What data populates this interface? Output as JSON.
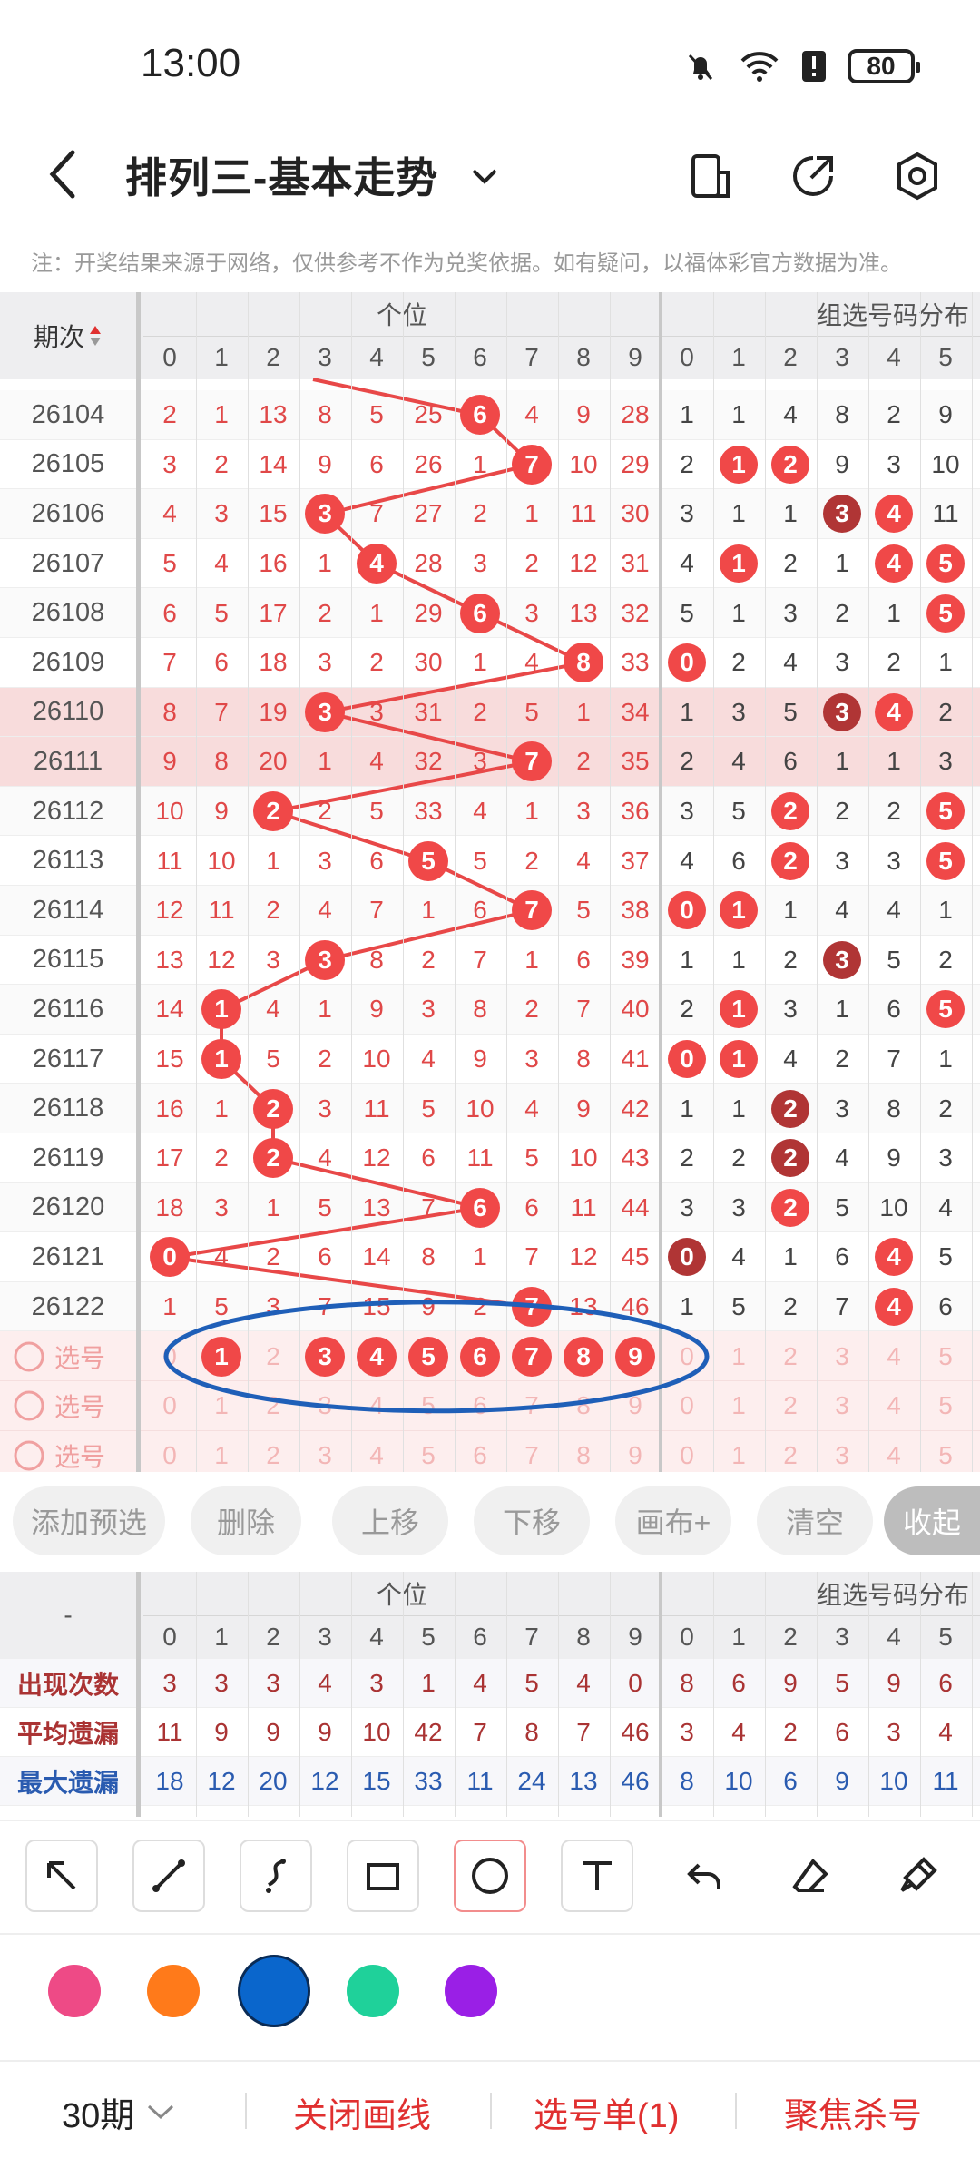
{
  "status_bar": {
    "time": "13:00",
    "battery": "80"
  },
  "header": {
    "title": "排列三-基本走势"
  },
  "note": "注：开奖结果来源于网络，仅供参考不作为兑奖依据。如有疑问，以福体彩官方数据为准。",
  "table": {
    "period_header": "期次",
    "group_unit": "个位",
    "group_combo": "组选号码分布",
    "digits": [
      "0",
      "1",
      "2",
      "3",
      "4",
      "5",
      "6",
      "7",
      "8",
      "9"
    ],
    "combo_digits": [
      "0",
      "1",
      "2",
      "3",
      "4",
      "5"
    ],
    "rows": [
      {
        "period": "26104",
        "unit": [
          "2",
          "1",
          "13",
          "8",
          "5",
          "25",
          "6",
          "4",
          "9",
          "28"
        ],
        "combo": [
          "1",
          "1",
          "4",
          "8",
          "2",
          "9"
        ],
        "unit_hit": 6,
        "combo_hits": []
      },
      {
        "period": "26105",
        "unit": [
          "3",
          "2",
          "14",
          "9",
          "6",
          "26",
          "1",
          "7",
          "10",
          "29"
        ],
        "combo": [
          "2",
          "1",
          "2",
          "9",
          "3",
          "10"
        ],
        "unit_hit": 7,
        "combo_hits": [
          1,
          2
        ]
      },
      {
        "period": "26106",
        "unit": [
          "4",
          "3",
          "15",
          "3",
          "7",
          "27",
          "2",
          "1",
          "11",
          "30"
        ],
        "combo": [
          "3",
          "1",
          "1",
          "3",
          "4",
          "11"
        ],
        "unit_hit": 3,
        "combo_hits": [
          3,
          4
        ],
        "dark": [
          3
        ]
      },
      {
        "period": "26107",
        "unit": [
          "5",
          "4",
          "16",
          "1",
          "4",
          "28",
          "3",
          "2",
          "12",
          "31"
        ],
        "combo": [
          "4",
          "1",
          "2",
          "1",
          "4",
          "5"
        ],
        "unit_hit": 4,
        "combo_hits": [
          1,
          4,
          5
        ]
      },
      {
        "period": "26108",
        "unit": [
          "6",
          "5",
          "17",
          "2",
          "1",
          "29",
          "6",
          "3",
          "13",
          "32"
        ],
        "combo": [
          "5",
          "1",
          "3",
          "2",
          "1",
          "5"
        ],
        "unit_hit": 6,
        "combo_hits": [
          5
        ]
      },
      {
        "period": "26109",
        "unit": [
          "7",
          "6",
          "18",
          "3",
          "2",
          "30",
          "1",
          "4",
          "8",
          "33"
        ],
        "combo": [
          "0",
          "2",
          "4",
          "3",
          "2",
          "1"
        ],
        "unit_hit": 8,
        "combo_hits": [
          0
        ]
      },
      {
        "period": "26110",
        "unit": [
          "8",
          "7",
          "19",
          "3",
          "3",
          "31",
          "2",
          "5",
          "1",
          "34"
        ],
        "combo": [
          "1",
          "3",
          "5",
          "3",
          "4",
          "2"
        ],
        "unit_hit": 3,
        "combo_hits": [
          3,
          4
        ],
        "dark": [
          3
        ]
      },
      {
        "period": "26111",
        "unit": [
          "9",
          "8",
          "20",
          "1",
          "4",
          "32",
          "3",
          "7",
          "2",
          "35"
        ],
        "combo": [
          "2",
          "4",
          "6",
          "1",
          "1",
          "3"
        ],
        "unit_hit": 7,
        "combo_hits": []
      },
      {
        "period": "26112",
        "unit": [
          "10",
          "9",
          "2",
          "2",
          "5",
          "33",
          "4",
          "1",
          "3",
          "36"
        ],
        "combo": [
          "3",
          "5",
          "2",
          "2",
          "2",
          "5"
        ],
        "unit_hit": 2,
        "combo_hits": [
          2,
          5
        ]
      },
      {
        "period": "26113",
        "unit": [
          "11",
          "10",
          "1",
          "3",
          "6",
          "5",
          "5",
          "2",
          "4",
          "37"
        ],
        "combo": [
          "4",
          "6",
          "2",
          "3",
          "3",
          "5"
        ],
        "unit_hit": 5,
        "combo_hits": [
          2,
          5
        ]
      },
      {
        "period": "26114",
        "unit": [
          "12",
          "11",
          "2",
          "4",
          "7",
          "1",
          "6",
          "7",
          "5",
          "38"
        ],
        "combo": [
          "0",
          "1",
          "1",
          "4",
          "4",
          "1"
        ],
        "unit_hit": 7,
        "combo_hits": [
          0,
          1
        ]
      },
      {
        "period": "26115",
        "unit": [
          "13",
          "12",
          "3",
          "3",
          "8",
          "2",
          "7",
          "1",
          "6",
          "39"
        ],
        "combo": [
          "1",
          "1",
          "2",
          "3",
          "5",
          "2"
        ],
        "unit_hit": 3,
        "combo_hits": [
          3
        ],
        "dark": [
          3
        ]
      },
      {
        "period": "26116",
        "unit": [
          "14",
          "1",
          "4",
          "1",
          "9",
          "3",
          "8",
          "2",
          "7",
          "40"
        ],
        "combo": [
          "2",
          "1",
          "3",
          "1",
          "6",
          "5"
        ],
        "unit_hit": 1,
        "combo_hits": [
          1,
          5
        ]
      },
      {
        "period": "26117",
        "unit": [
          "15",
          "1",
          "5",
          "2",
          "10",
          "4",
          "9",
          "3",
          "8",
          "41"
        ],
        "combo": [
          "0",
          "1",
          "4",
          "2",
          "7",
          "1"
        ],
        "unit_hit": 1,
        "combo_hits": [
          0,
          1
        ]
      },
      {
        "period": "26118",
        "unit": [
          "16",
          "1",
          "2",
          "3",
          "11",
          "5",
          "10",
          "4",
          "9",
          "42"
        ],
        "combo": [
          "1",
          "1",
          "2",
          "3",
          "8",
          "2"
        ],
        "unit_hit": 2,
        "combo_hits": [
          2
        ],
        "dark": [
          2
        ]
      },
      {
        "period": "26119",
        "unit": [
          "17",
          "2",
          "2",
          "4",
          "12",
          "6",
          "11",
          "5",
          "10",
          "43"
        ],
        "combo": [
          "2",
          "2",
          "2",
          "4",
          "9",
          "3"
        ],
        "unit_hit": 2,
        "combo_hits": [
          2
        ],
        "dark": [
          2
        ]
      },
      {
        "period": "26120",
        "unit": [
          "18",
          "3",
          "1",
          "5",
          "13",
          "7",
          "6",
          "6",
          "11",
          "44"
        ],
        "combo": [
          "3",
          "3",
          "2",
          "5",
          "10",
          "4"
        ],
        "unit_hit": 6,
        "combo_hits": [
          2
        ]
      },
      {
        "period": "26121",
        "unit": [
          "0",
          "4",
          "2",
          "6",
          "14",
          "8",
          "1",
          "7",
          "12",
          "45"
        ],
        "combo": [
          "0",
          "4",
          "1",
          "6",
          "4",
          "5"
        ],
        "unit_hit": 0,
        "combo_hits": [
          0,
          4
        ],
        "dark": [
          0
        ]
      },
      {
        "period": "26122",
        "unit": [
          "1",
          "5",
          "3",
          "7",
          "15",
          "9",
          "2",
          "7",
          "13",
          "46"
        ],
        "combo": [
          "1",
          "5",
          "2",
          "7",
          "4",
          "6"
        ],
        "unit_hit": 7,
        "combo_hits": [
          4
        ]
      }
    ],
    "pick_label": "选号",
    "pick_selected": [
      1,
      3,
      4,
      5,
      6,
      7,
      8,
      9
    ]
  },
  "buttons": [
    "添加预选",
    "删除",
    "上移",
    "下移",
    "画布+",
    "清空",
    "收起"
  ],
  "stats": {
    "dash": "-",
    "rows": [
      {
        "label": "出现次数",
        "unit": [
          "3",
          "3",
          "3",
          "4",
          "3",
          "1",
          "4",
          "5",
          "4",
          "0"
        ],
        "combo": [
          "8",
          "6",
          "9",
          "5",
          "9",
          "6"
        ],
        "color": "#a33"
      },
      {
        "label": "平均遗漏",
        "unit": [
          "11",
          "9",
          "9",
          "9",
          "10",
          "42",
          "7",
          "8",
          "7",
          "46"
        ],
        "combo": [
          "3",
          "4",
          "2",
          "6",
          "3",
          "4"
        ],
        "color": "#a33"
      },
      {
        "label": "最大遗漏",
        "unit": [
          "18",
          "12",
          "20",
          "12",
          "15",
          "33",
          "11",
          "24",
          "13",
          "46"
        ],
        "combo": [
          "8",
          "10",
          "6",
          "9",
          "10",
          "11"
        ],
        "color": "#2a5bb0"
      }
    ]
  },
  "tools": [
    "arrow-tool-icon",
    "line-tool-icon",
    "curve-tool-icon",
    "rect-tool-icon",
    "circle-tool-icon",
    "text-tool-icon",
    "undo-icon",
    "eraser-icon",
    "clear-brush-icon"
  ],
  "colors": [
    "#ee4a86",
    "#ff7a1a",
    "#0a66cc",
    "#1fd19a",
    "#9a1fe6"
  ],
  "bottom": {
    "periods": "30期",
    "close_line": "关闭画线",
    "pick_list": "选号单(1)",
    "focus_kill": "聚焦杀号"
  }
}
